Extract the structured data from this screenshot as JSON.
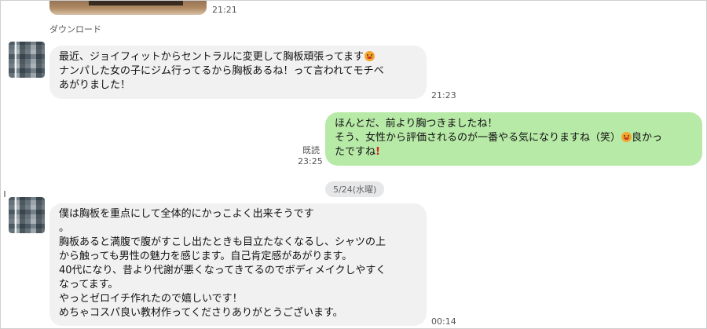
{
  "messages": [
    {
      "time": "21:21"
    },
    {
      "lines": [
        "最近、ジョイフィットからセントラルに変更して胸板頑張ってます",
        "ナンパした女の子にジム行ってるから胸板あるね！って言われてモチベ",
        "あがりました！"
      ],
      "time": "21:23"
    },
    {
      "lines": [
        "ほんとだ、前より胸つきましたね！",
        "そう、女性から評価されるのが一番やる気になりますね（笑）",
        "良かっ",
        "たですね"
      ],
      "read_label": "既読",
      "time": "23:25"
    },
    {
      "lines": [
        "僕は胸板を重点にして全体的にかっこよく出来そうです",
        "。",
        "胸板あると満腹で腹がすこし出たときも目立たなくなるし、シャツの上",
        "から触っても男性の魅力を感じます。自己肯定感があがります。",
        "40代になり、昔より代謝が悪くなってきてるのでボディメイクしやすく",
        "なってます。",
        "やっとゼロイチ作れたので嬉しいです！",
        "めちゃコスパ良い教材作ってくださりありがとうございます。"
      ],
      "time": "00:14"
    }
  ],
  "download_label": "ダウンロード",
  "date_separator": "5/24(水曜)",
  "colors": {
    "incoming_bubble": "#f1f1f2",
    "outgoing_bubble": "#b7e9a7",
    "background": "#ffffff"
  },
  "icons": {
    "smile": "smiling-face-emoji",
    "exclamation": "red-exclamation-mark"
  }
}
